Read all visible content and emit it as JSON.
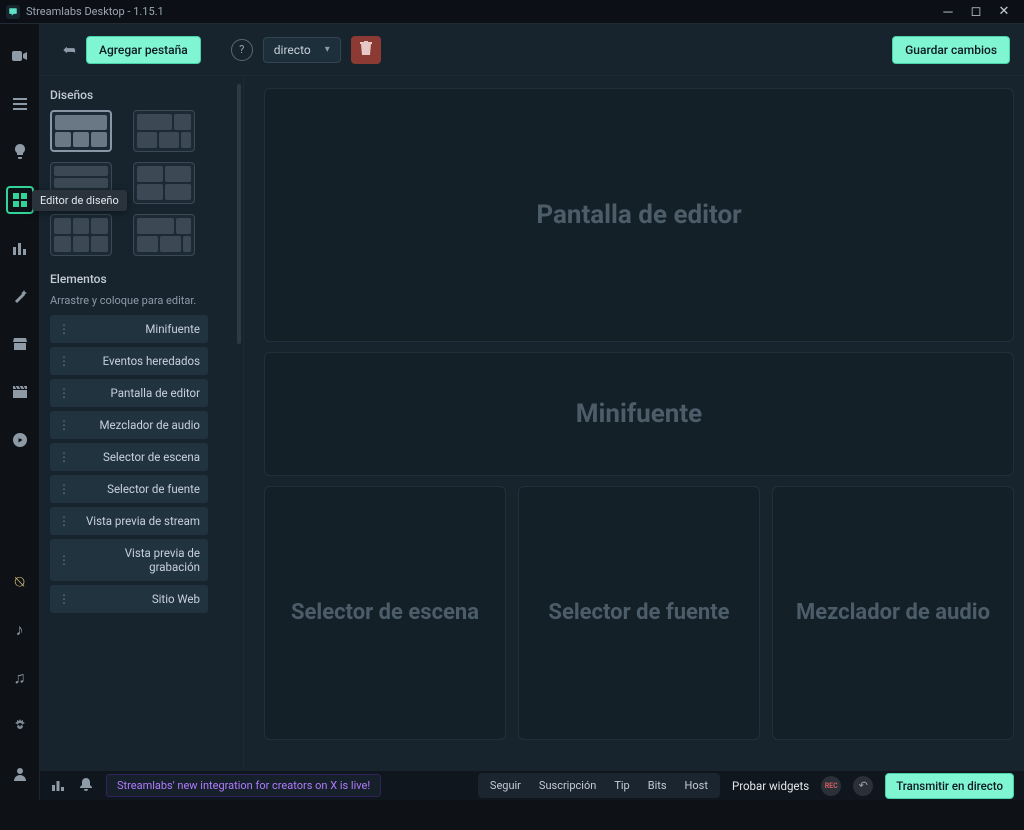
{
  "window": {
    "title": "Streamlabs Desktop - 1.15.1"
  },
  "tooltip": {
    "layout_editor": "Editor de diseño"
  },
  "toolbar": {
    "add_tab": "Agregar pestaña",
    "dropdown_value": "directo",
    "save": "Guardar cambios"
  },
  "sidebar": {
    "designs_label": "Diseños",
    "elements_label": "Elementos",
    "elements_hint": "Arrastre y coloque para editar.",
    "elements": [
      "Minifuente",
      "Eventos heredados",
      "Pantalla de editor",
      "Mezclador de audio",
      "Selector de escena",
      "Selector de fuente",
      "Vista previa de stream",
      "Vista previa de grabación",
      "Sitio Web"
    ]
  },
  "canvas": {
    "zone1": "Pantalla de editor",
    "zone2": "Minifuente",
    "zone3": "Selector de escena",
    "zone4": "Selector de fuente",
    "zone5": "Mezclador de audio"
  },
  "footer": {
    "news": "Streamlabs' new integration for creators on X is live!",
    "seg": [
      "Seguir",
      "Suscripción",
      "Tip",
      "Bits",
      "Host"
    ],
    "test_widgets": "Probar widgets",
    "rec": "REC",
    "go_live": "Transmitir en directo"
  }
}
